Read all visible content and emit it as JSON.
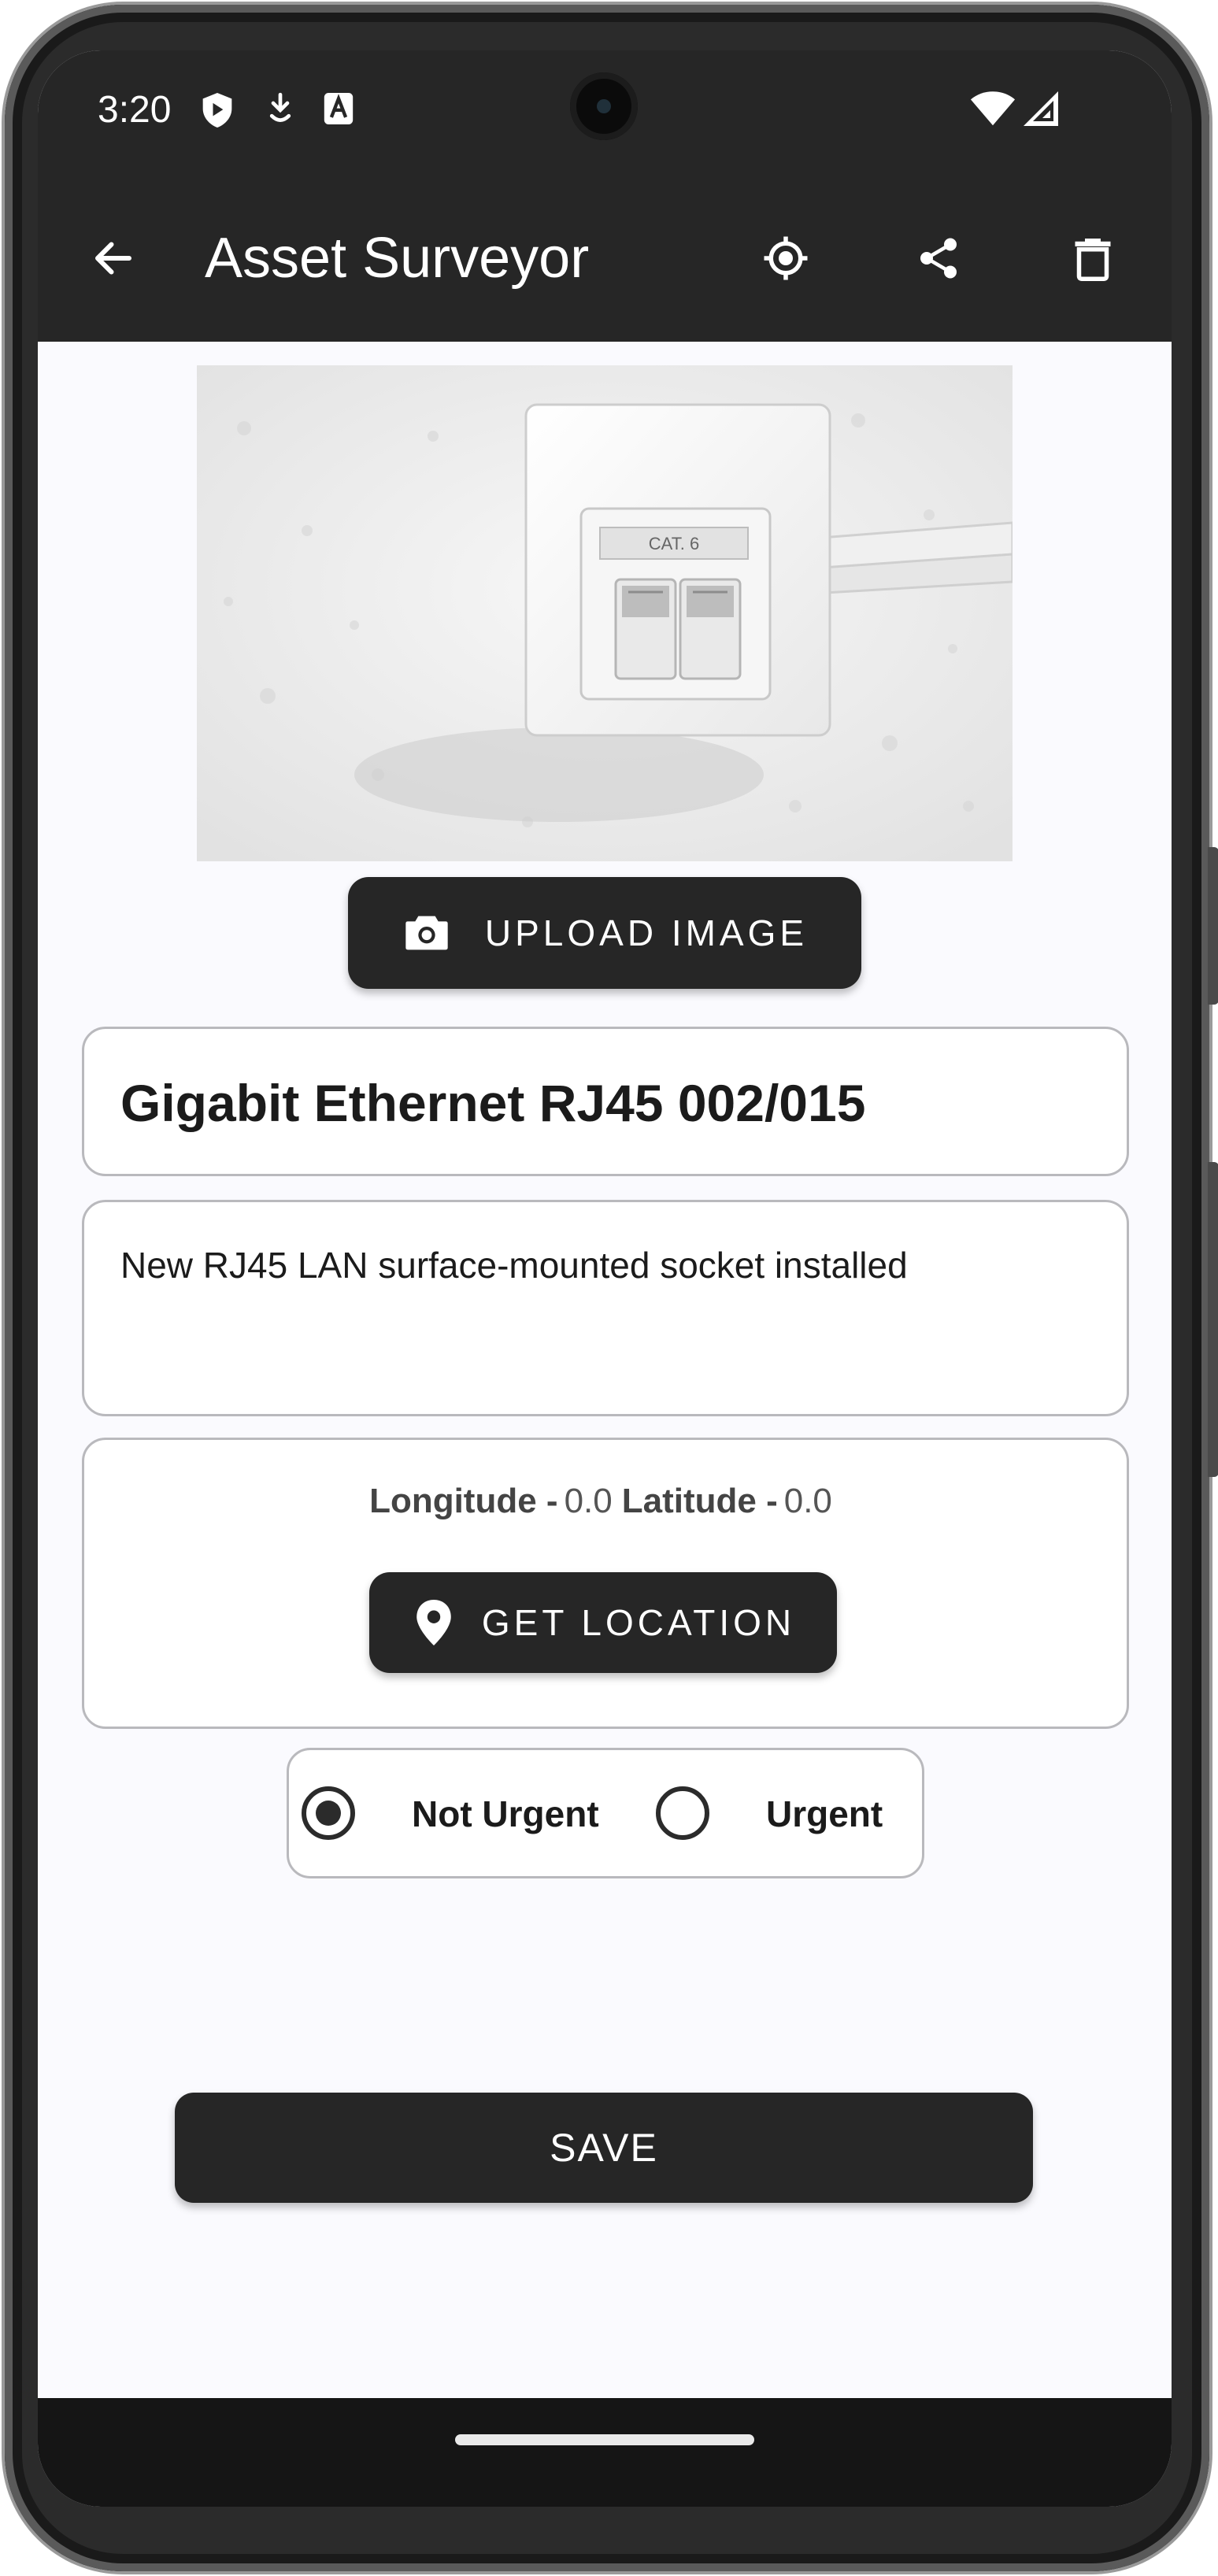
{
  "status_bar": {
    "time": "3:20",
    "icons": [
      "shield-icon",
      "download-icon",
      "a-badge-icon",
      "wifi-icon",
      "cell-signal-icon"
    ]
  },
  "app_bar": {
    "title": "Asset Surveyor",
    "actions": [
      "back-arrow-icon",
      "my-location-icon",
      "share-icon",
      "delete-icon"
    ]
  },
  "photo": {
    "plate_label": "CAT. 6"
  },
  "upload_button": {
    "label": "UPLOAD IMAGE",
    "icon": "camera-icon"
  },
  "asset": {
    "title": "Gigabit Ethernet RJ45 002/015",
    "description": "New RJ45 LAN surface-mounted socket installed"
  },
  "location": {
    "longitude_label": "Longitude -",
    "longitude_value": "0.0",
    "latitude_label": "Latitude -",
    "latitude_value": "0.0",
    "button_label": "GET LOCATION",
    "button_icon": "location-pin-icon"
  },
  "priority": {
    "options": [
      {
        "label": "Not Urgent",
        "selected": true
      },
      {
        "label": "Urgent",
        "selected": false
      }
    ]
  },
  "save_button": {
    "label": "SAVE"
  },
  "colors": {
    "bar": "#262626",
    "background": "#fafafe",
    "accent": "#262626",
    "outline": "#b9b9bd"
  }
}
